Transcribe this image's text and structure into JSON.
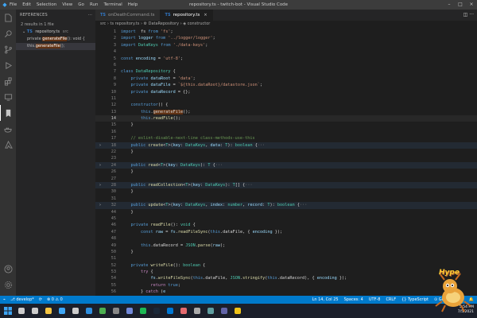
{
  "window": {
    "title": "repository.ts - twitch-bot - Visual Studio Code",
    "menu": [
      "File",
      "Edit",
      "Selection",
      "View",
      "Go",
      "Run",
      "Terminal",
      "Help"
    ]
  },
  "activity_icons": [
    "explorer-icon",
    "search-icon",
    "source-control-icon",
    "run-debug-icon",
    "extensions-icon",
    "remote-explorer-icon",
    "bookmark-icon",
    "docker-icon",
    "azure-icon"
  ],
  "sidebar": {
    "header": "REFERENCES",
    "summary": "2 results in 1 file",
    "file": {
      "badge": "TS",
      "name": "repository.ts",
      "path": "src"
    },
    "matches": [
      {
        "before": "private ",
        "match": "generateFile",
        "after": "(): void {"
      },
      {
        "before": "this.",
        "match": "generateFile",
        "after": "();"
      }
    ]
  },
  "tabs": [
    {
      "badge": "TS",
      "label": "onDeathCommand.ts",
      "close": "×"
    },
    {
      "badge": "TS",
      "label": "repository.ts",
      "close": "×"
    }
  ],
  "breadcrumb": "src › ts repository.ts › ⚙ DataRepository › ◈ constructor",
  "code": [
    {
      "n": "1",
      "parts": [
        [
          "k",
          "import"
        ],
        [
          "",
          "  fs "
        ],
        [
          "k",
          "from"
        ],
        [
          "s",
          " 'fs'"
        ],
        [
          "",
          ";"
        ]
      ]
    },
    {
      "n": "2",
      "parts": [
        [
          "k",
          "import"
        ],
        [
          "v",
          " logger "
        ],
        [
          "k",
          "from"
        ],
        [
          "s",
          " '../logger/logger'"
        ],
        [
          "",
          ";"
        ]
      ]
    },
    {
      "n": "3",
      "parts": [
        [
          "k",
          "import"
        ],
        [
          "t",
          " DataKeys "
        ],
        [
          "k",
          "from"
        ],
        [
          "s",
          " './data-keys'"
        ],
        [
          "",
          ";"
        ]
      ]
    },
    {
      "n": "4",
      "parts": []
    },
    {
      "n": "5",
      "parts": [
        [
          "k",
          "const"
        ],
        [
          "v",
          " encoding "
        ],
        [
          "",
          "= "
        ],
        [
          "s",
          "'utf-8'"
        ],
        [
          "",
          ";"
        ]
      ]
    },
    {
      "n": "6",
      "parts": []
    },
    {
      "n": "7",
      "parts": [
        [
          "k",
          "class"
        ],
        [
          "t",
          " DataRepository "
        ],
        [
          "",
          "{"
        ]
      ]
    },
    {
      "n": "8",
      "parts": [
        [
          "",
          "    "
        ],
        [
          "k",
          "private"
        ],
        [
          "v",
          " dataRoot "
        ],
        [
          "",
          "= "
        ],
        [
          "s",
          "'data'"
        ],
        [
          "",
          ";"
        ]
      ]
    },
    {
      "n": "9",
      "parts": [
        [
          "",
          "    "
        ],
        [
          "k",
          "private"
        ],
        [
          "v",
          " dataFile "
        ],
        [
          "",
          "= "
        ],
        [
          "s",
          "`${this.dataRoot}/datastore.json`"
        ],
        [
          "",
          ";"
        ]
      ]
    },
    {
      "n": "10",
      "parts": [
        [
          "",
          "    "
        ],
        [
          "k",
          "private"
        ],
        [
          "v",
          " dataRecord "
        ],
        [
          "",
          "= {};"
        ]
      ]
    },
    {
      "n": "11",
      "parts": []
    },
    {
      "n": "12",
      "parts": [
        [
          "",
          "    "
        ],
        [
          "k",
          "constructor"
        ],
        [
          "",
          "() {"
        ]
      ]
    },
    {
      "n": "13",
      "parts": [
        [
          "",
          "        "
        ],
        [
          "k",
          "this"
        ],
        [
          "",
          "."
        ],
        [
          "hl",
          "generateFile"
        ],
        [
          "",
          "();"
        ]
      ]
    },
    {
      "n": "14",
      "parts": [
        [
          "",
          "        "
        ],
        [
          "k",
          "this"
        ],
        [
          "",
          "."
        ],
        [
          "f",
          "readFile"
        ],
        [
          "",
          "();"
        ]
      ],
      "cur": true
    },
    {
      "n": "15",
      "parts": [
        [
          "",
          "    }"
        ]
      ]
    },
    {
      "n": "16",
      "parts": []
    },
    {
      "n": "17",
      "parts": [
        [
          "c",
          "    // eslint-disable-next-line class-methods-use-this"
        ]
      ]
    },
    {
      "n": "18",
      "parts": [
        [
          "",
          "    "
        ],
        [
          "k",
          "public"
        ],
        [
          "f",
          " create"
        ],
        [
          "",
          "<"
        ],
        [
          "t",
          "T"
        ],
        [
          "",
          ">("
        ],
        [
          "v",
          "key"
        ],
        [
          "",
          ": "
        ],
        [
          "t",
          "DataKeys"
        ],
        [
          "",
          ", "
        ],
        [
          "v",
          "data"
        ],
        [
          "",
          ": "
        ],
        [
          "t",
          "T"
        ],
        [
          "",
          "): "
        ],
        [
          "t",
          "boolean"
        ],
        [
          "",
          " {"
        ],
        [
          "ghost",
          "···"
        ]
      ],
      "fold": true
    },
    {
      "n": "22",
      "parts": [
        [
          "",
          "    }"
        ]
      ]
    },
    {
      "n": "23",
      "parts": []
    },
    {
      "n": "24",
      "parts": [
        [
          "",
          "    "
        ],
        [
          "k",
          "public"
        ],
        [
          "f",
          " read"
        ],
        [
          "",
          "<"
        ],
        [
          "t",
          "T"
        ],
        [
          "",
          ">("
        ],
        [
          "v",
          "key"
        ],
        [
          "",
          ": "
        ],
        [
          "t",
          "DataKeys"
        ],
        [
          "",
          "): "
        ],
        [
          "t",
          "T"
        ],
        [
          "",
          " {"
        ],
        [
          "ghost",
          "···"
        ]
      ],
      "fold": true
    },
    {
      "n": "26",
      "parts": [
        [
          "",
          "    }"
        ]
      ]
    },
    {
      "n": "27",
      "parts": []
    },
    {
      "n": "28",
      "parts": [
        [
          "",
          "    "
        ],
        [
          "k",
          "public"
        ],
        [
          "f",
          " readCollection"
        ],
        [
          "",
          "<"
        ],
        [
          "t",
          "T"
        ],
        [
          "",
          ">("
        ],
        [
          "v",
          "key"
        ],
        [
          "",
          ": "
        ],
        [
          "t",
          "DataKeys"
        ],
        [
          "",
          "): "
        ],
        [
          "t",
          "T"
        ],
        [
          "",
          "[] {"
        ],
        [
          "ghost",
          "···"
        ]
      ],
      "fold": true
    },
    {
      "n": "30",
      "parts": [
        [
          "",
          "    }"
        ]
      ]
    },
    {
      "n": "31",
      "parts": []
    },
    {
      "n": "32",
      "parts": [
        [
          "",
          "    "
        ],
        [
          "k",
          "public"
        ],
        [
          "f",
          " update"
        ],
        [
          "",
          "<"
        ],
        [
          "t",
          "T"
        ],
        [
          "",
          ">("
        ],
        [
          "v",
          "key"
        ],
        [
          "",
          ": "
        ],
        [
          "t",
          "DataKeys"
        ],
        [
          "",
          ", "
        ],
        [
          "v",
          "index"
        ],
        [
          "",
          ": "
        ],
        [
          "t",
          "number"
        ],
        [
          "",
          ", "
        ],
        [
          "v",
          "record"
        ],
        [
          "",
          ": "
        ],
        [
          "t",
          "T"
        ],
        [
          "",
          "): "
        ],
        [
          "t",
          "boolean"
        ],
        [
          "",
          " {"
        ],
        [
          "ghost",
          "···"
        ]
      ],
      "fold": true
    },
    {
      "n": "44",
      "parts": [
        [
          "",
          "    }"
        ]
      ]
    },
    {
      "n": "45",
      "parts": []
    },
    {
      "n": "46",
      "parts": [
        [
          "",
          "    "
        ],
        [
          "k",
          "private"
        ],
        [
          "f",
          " readFile"
        ],
        [
          "",
          "(): "
        ],
        [
          "t",
          "void"
        ],
        [
          "",
          " {"
        ]
      ]
    },
    {
      "n": "47",
      "parts": [
        [
          "",
          "        "
        ],
        [
          "k",
          "const"
        ],
        [
          "v",
          " raw "
        ],
        [
          "",
          "= "
        ],
        [
          "v",
          "fs"
        ],
        [
          "",
          "."
        ],
        [
          "f",
          "readFileSync"
        ],
        [
          "",
          "("
        ],
        [
          "k",
          "this"
        ],
        [
          "",
          ".dataFile, { "
        ],
        [
          "v",
          "encoding"
        ],
        [
          "",
          " });"
        ]
      ]
    },
    {
      "n": "48",
      "parts": []
    },
    {
      "n": "49",
      "parts": [
        [
          "",
          "        "
        ],
        [
          "k",
          "this"
        ],
        [
          "",
          ".dataRecord = "
        ],
        [
          "t",
          "JSON"
        ],
        [
          "",
          "."
        ],
        [
          "f",
          "parse"
        ],
        [
          "",
          "("
        ],
        [
          "v",
          "raw"
        ],
        [
          "",
          ");"
        ]
      ]
    },
    {
      "n": "50",
      "parts": [
        [
          "",
          "    }"
        ]
      ]
    },
    {
      "n": "51",
      "parts": []
    },
    {
      "n": "52",
      "parts": [
        [
          "",
          "    "
        ],
        [
          "k",
          "private"
        ],
        [
          "f",
          " writeFile"
        ],
        [
          "",
          "(): "
        ],
        [
          "t",
          "boolean"
        ],
        [
          "",
          " {"
        ]
      ]
    },
    {
      "n": "53",
      "parts": [
        [
          "",
          "        "
        ],
        [
          "p",
          "try"
        ],
        [
          "",
          " {"
        ]
      ]
    },
    {
      "n": "54",
      "parts": [
        [
          "",
          "            "
        ],
        [
          "v",
          "fs"
        ],
        [
          "",
          "."
        ],
        [
          "f",
          "writeFileSync"
        ],
        [
          "",
          "("
        ],
        [
          "k",
          "this"
        ],
        [
          "",
          ".dataFile, "
        ],
        [
          "t",
          "JSON"
        ],
        [
          "",
          "."
        ],
        [
          "f",
          "stringify"
        ],
        [
          "",
          "("
        ],
        [
          "k",
          "this"
        ],
        [
          "",
          ".dataRecord), { "
        ],
        [
          "v",
          "encoding"
        ],
        [
          "",
          " });"
        ]
      ]
    },
    {
      "n": "55",
      "parts": [
        [
          "",
          "            "
        ],
        [
          "p",
          "return"
        ],
        [
          "k",
          " true"
        ],
        [
          "",
          ";"
        ]
      ]
    },
    {
      "n": "56",
      "parts": [
        [
          "",
          "        } "
        ],
        [
          "p",
          "catch"
        ],
        [
          "",
          " ("
        ],
        [
          "v",
          "e"
        ],
        [
          ") {"
        ]
      ]
    }
  ],
  "statusbar": {
    "branch": "develop*",
    "sync": "⟳",
    "problems": "⊗ 0 ⚠ 0",
    "position": "Ln 14, Col 25",
    "spaces": "Spaces: 4",
    "encoding": "UTF-8",
    "eol": "CRLF",
    "language": "{} TypeScript",
    "golive": "⊙ Go Live"
  },
  "taskbar": {
    "apps": [
      "windows-start-icon",
      "search-icon",
      "task-view-icon",
      "file-explorer-icon",
      "vscode-icon",
      "terminal-icon",
      "browser-icon",
      "chrome-icon",
      "obs-icon",
      "discord-icon",
      "spotify-icon",
      "steam-icon",
      "mail-icon",
      "photos-icon",
      "settings-icon",
      "store-icon",
      "teams-icon",
      "notes-icon"
    ],
    "time": "5:54 PM",
    "date": "7/5/2021"
  },
  "overlay": {
    "text": "Hype"
  },
  "colors": {
    "accent": "#007acc",
    "activity_bar": "#333333",
    "sidebar": "#252526",
    "editor": "#1e1e1e",
    "match_highlight": "#613214"
  }
}
